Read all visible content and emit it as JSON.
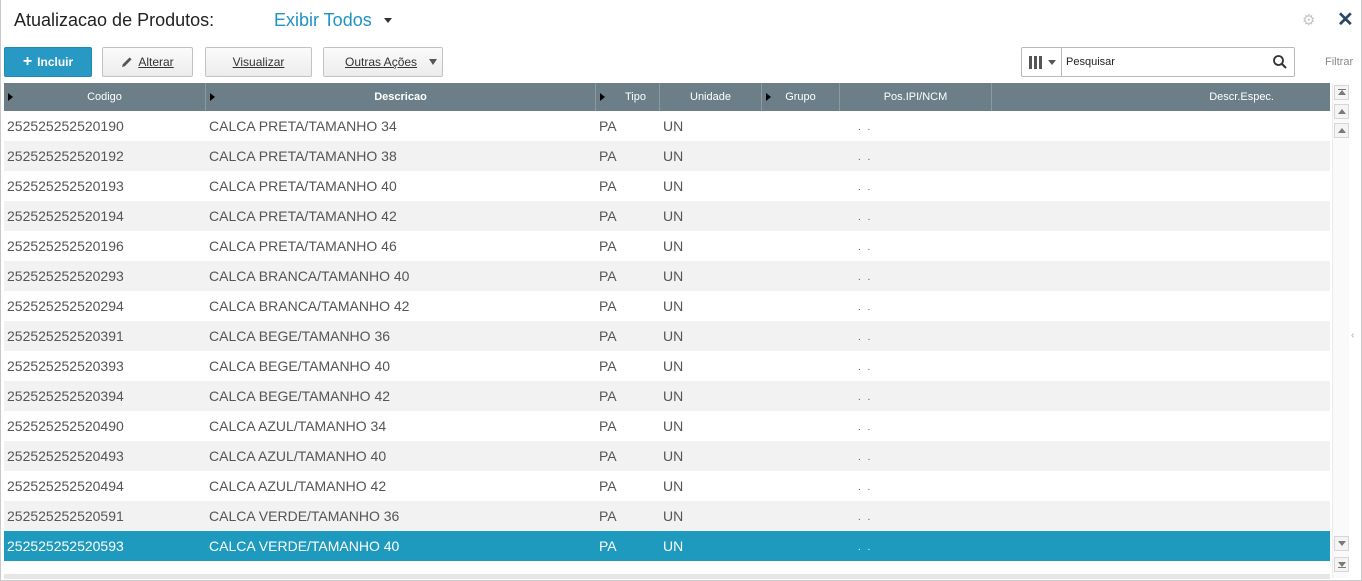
{
  "header": {
    "title": "Atualizacao de Produtos:",
    "view_filter": "Exibir Todos"
  },
  "toolbar": {
    "include_label": "Incluir",
    "alter_label": "Alterar",
    "view_label": "Visualizar",
    "more_label": "Outras Ações",
    "search_placeholder": "Pesquisar",
    "filter_label": "Filtrar"
  },
  "grid": {
    "columns": [
      "Codigo",
      "Descricao",
      "Tipo",
      "Unidade",
      "Grupo",
      "Pos.IPI/NCM",
      "Descr.Espec."
    ],
    "rows": [
      {
        "codigo": "252525252520190",
        "descricao": "CALCA PRETA/TAMANHO 34",
        "tipo": "PA",
        "unidade": "UN",
        "grupo": "",
        "ncm": ". .",
        "descr_espec": ""
      },
      {
        "codigo": "252525252520192",
        "descricao": "CALCA PRETA/TAMANHO 38",
        "tipo": "PA",
        "unidade": "UN",
        "grupo": "",
        "ncm": ". .",
        "descr_espec": ""
      },
      {
        "codigo": "252525252520193",
        "descricao": "CALCA PRETA/TAMANHO 40",
        "tipo": "PA",
        "unidade": "UN",
        "grupo": "",
        "ncm": ". .",
        "descr_espec": ""
      },
      {
        "codigo": "252525252520194",
        "descricao": "CALCA PRETA/TAMANHO 42",
        "tipo": "PA",
        "unidade": "UN",
        "grupo": "",
        "ncm": ". .",
        "descr_espec": ""
      },
      {
        "codigo": "252525252520196",
        "descricao": "CALCA PRETA/TAMANHO 46",
        "tipo": "PA",
        "unidade": "UN",
        "grupo": "",
        "ncm": ". .",
        "descr_espec": ""
      },
      {
        "codigo": "252525252520293",
        "descricao": "CALCA BRANCA/TAMANHO 40",
        "tipo": "PA",
        "unidade": "UN",
        "grupo": "",
        "ncm": ". .",
        "descr_espec": ""
      },
      {
        "codigo": "252525252520294",
        "descricao": "CALCA BRANCA/TAMANHO 42",
        "tipo": "PA",
        "unidade": "UN",
        "grupo": "",
        "ncm": ". .",
        "descr_espec": ""
      },
      {
        "codigo": "252525252520391",
        "descricao": "CALCA BEGE/TAMANHO 36",
        "tipo": "PA",
        "unidade": "UN",
        "grupo": "",
        "ncm": ". .",
        "descr_espec": ""
      },
      {
        "codigo": "252525252520393",
        "descricao": "CALCA BEGE/TAMANHO 40",
        "tipo": "PA",
        "unidade": "UN",
        "grupo": "",
        "ncm": ". .",
        "descr_espec": ""
      },
      {
        "codigo": "252525252520394",
        "descricao": "CALCA BEGE/TAMANHO 42",
        "tipo": "PA",
        "unidade": "UN",
        "grupo": "",
        "ncm": ". .",
        "descr_espec": ""
      },
      {
        "codigo": "252525252520490",
        "descricao": "CALCA AZUL/TAMANHO 34",
        "tipo": "PA",
        "unidade": "UN",
        "grupo": "",
        "ncm": ". .",
        "descr_espec": ""
      },
      {
        "codigo": "252525252520493",
        "descricao": "CALCA AZUL/TAMANHO 40",
        "tipo": "PA",
        "unidade": "UN",
        "grupo": "",
        "ncm": ". .",
        "descr_espec": ""
      },
      {
        "codigo": "252525252520494",
        "descricao": "CALCA AZUL/TAMANHO 42",
        "tipo": "PA",
        "unidade": "UN",
        "grupo": "",
        "ncm": ". .",
        "descr_espec": ""
      },
      {
        "codigo": "252525252520591",
        "descricao": "CALCA VERDE/TAMANHO 36",
        "tipo": "PA",
        "unidade": "UN",
        "grupo": "",
        "ncm": ". .",
        "descr_espec": ""
      },
      {
        "codigo": "252525252520593",
        "descricao": "CALCA VERDE/TAMANHO 40",
        "tipo": "PA",
        "unidade": "UN",
        "grupo": "",
        "ncm": ". .",
        "descr_espec": "",
        "selected": true
      }
    ]
  },
  "colors": {
    "accent": "#1f94c4",
    "primary_button": "#2799c4",
    "header_bg": "#6c7f88",
    "selected_row": "#1e9abf",
    "alt_row": "#f2f2f2"
  },
  "icons": {
    "settings": "gear-icon",
    "close": "close-icon",
    "search": "search-icon",
    "columns": "columns-icon",
    "edit": "pencil-icon",
    "add": "plus-icon"
  }
}
